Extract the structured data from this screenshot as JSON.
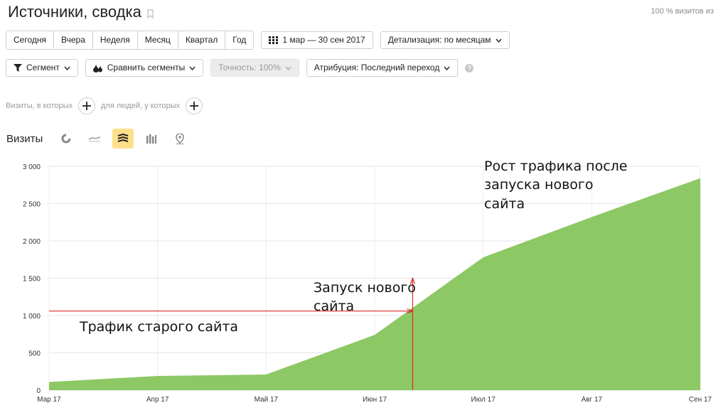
{
  "header": {
    "title": "Источники, сводка",
    "visits_pct": "100 % визитов из"
  },
  "period_buttons": [
    "Сегодня",
    "Вчера",
    "Неделя",
    "Месяц",
    "Квартал",
    "Год"
  ],
  "date_range": "1 мар — 30 сен 2017",
  "detail": "Детализация: по месяцам",
  "segment": "Сегмент",
  "compare": "Сравнить сегменты",
  "accuracy": "Точность: 100%",
  "attribution": "Атрибуция: Последний переход",
  "filter": {
    "visits_label": "Визиты, в которых",
    "people_label": "для людей, у которых"
  },
  "chart_header": {
    "title": "Визиты"
  },
  "colors": {
    "area": "#8cc864",
    "annotation_line": "#e0282a",
    "active_type": "#ffe08a"
  },
  "chart_data": {
    "type": "area",
    "categories": [
      "Мар 17",
      "Апр 17",
      "Май 17",
      "Июн 17",
      "Июл 17",
      "Авг 17",
      "Сен 17"
    ],
    "series": [
      {
        "values": [
          110,
          190,
          210,
          740,
          1780,
          2320,
          2840
        ]
      }
    ],
    "ylim": [
      0,
      3000
    ],
    "yticks": [
      "0",
      "500",
      "1 000",
      "1 500",
      "2 000",
      "2 500",
      "3 000"
    ],
    "grid": true,
    "annotations": {
      "old_site": "Трафик старого сайта",
      "launch_line1": "Запуск нового",
      "launch_line2": "сайта",
      "growth_line1": "Рост трафика после",
      "growth_line2": "запуска нового",
      "growth_line3": "сайта",
      "launch_x": 3.35,
      "old_site_level": 1060
    }
  }
}
